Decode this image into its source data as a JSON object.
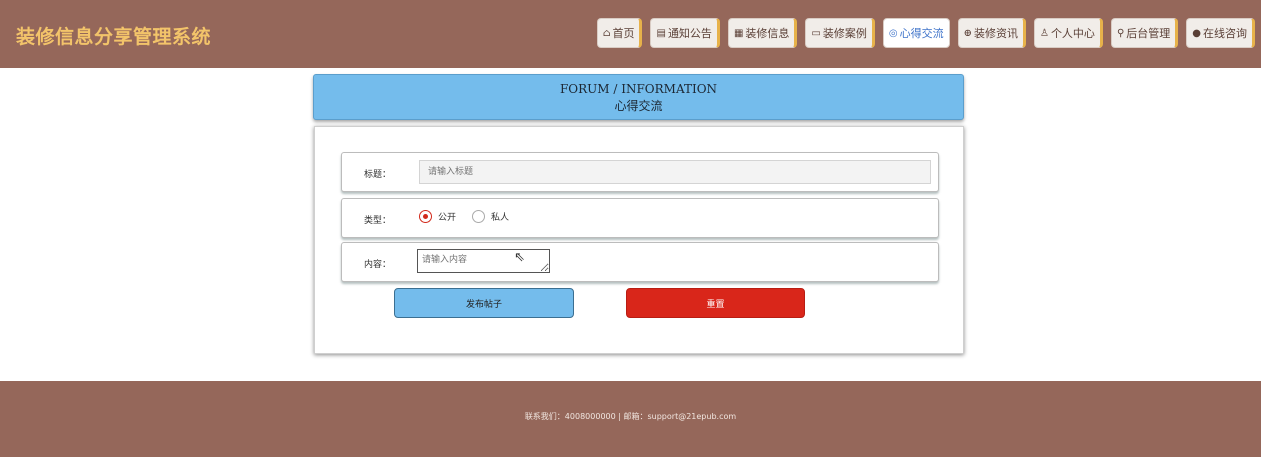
{
  "header": {
    "brand": "装修信息分享管理系统",
    "nav": [
      {
        "icon": "⌂",
        "label": "首页",
        "active": false
      },
      {
        "icon": "▤",
        "label": "通知公告",
        "active": false
      },
      {
        "icon": "▦",
        "label": "装修信息",
        "active": false
      },
      {
        "icon": "▭",
        "label": "装修案例",
        "active": false
      },
      {
        "icon": "◎",
        "label": "心得交流",
        "active": true
      },
      {
        "icon": "⊕",
        "label": "装修资讯",
        "active": false
      },
      {
        "icon": "♙",
        "label": "个人中心",
        "active": false
      },
      {
        "icon": "⚲",
        "label": "后台管理",
        "active": false
      },
      {
        "icon": "●",
        "label": "在线咨询",
        "active": false
      }
    ]
  },
  "section": {
    "title_en": "FORUM / INFORMATION",
    "title_cn": "心得交流"
  },
  "form": {
    "title_label": "标题：",
    "title_placeholder": "请输入标题",
    "type_label": "类型：",
    "type_options": [
      "公开",
      "私人"
    ],
    "type_selected": "公开",
    "content_label": "内容：",
    "content_placeholder": "请输入内容",
    "publish_label": "发布帖子",
    "reset_label": "重置"
  },
  "footer": {
    "text": "联系我们：4008000000 | 邮箱：support@21epub.com"
  },
  "colors": {
    "header_bg": "#95675a",
    "brand": "#f3c46a",
    "accent_blue": "#74bcec",
    "reset_red": "#d9261a",
    "radio_red": "#d2291b"
  }
}
